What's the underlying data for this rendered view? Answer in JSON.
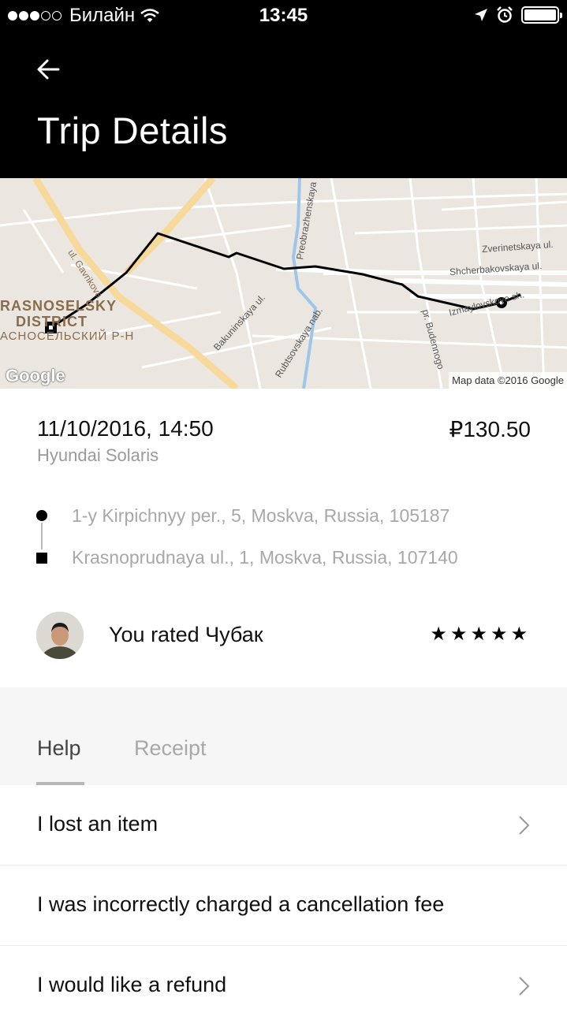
{
  "status_bar": {
    "carrier": "Билайн",
    "time": "13:45"
  },
  "header": {
    "title": "Trip Details"
  },
  "map": {
    "street_labels": {
      "gavrikova": "ul. Gavrikova",
      "preobrazhenskaya": "Preobrazhenskaya",
      "zverinetskaya": "Zverinetskaya ul.",
      "shcherbakovskaya": "Shcherbakovskaya ul.",
      "izmaylovskoye": "Izmaylovskoye sh.",
      "budennogo": "pr. Budennogo",
      "bakuninskaya": "Bakuninskaya ul.",
      "rubtsovskaya": "Rubtsovskaya nab."
    },
    "district_line1": "RASNOSELSKY",
    "district_line2": "DISTRICT",
    "district_ru": "АСНОСЕЛЬСКИЙ Р-Н",
    "provider_logo": "Google",
    "attribution": "Map data ©2016 Google"
  },
  "trip": {
    "datetime": "11/10/2016, 14:50",
    "price": "₽130.50",
    "car": "Hyundai Solaris",
    "pickup": "1-y Kirpichnyy per., 5, Moskva, Russia, 105187",
    "dropoff": "Krasnoprudnaya ul., 1, Moskva, Russia, 107140"
  },
  "rating": {
    "text": "You rated Чубак",
    "stars": "★★★★★",
    "star_count": 5
  },
  "tabs": [
    {
      "label": "Help",
      "active": true
    },
    {
      "label": "Receipt",
      "active": false
    }
  ],
  "help_items": [
    {
      "label": "I lost an item",
      "chevron": true
    },
    {
      "label": "I was incorrectly charged a cancellation fee",
      "chevron": false
    },
    {
      "label": "I would like a refund",
      "chevron": true
    }
  ]
}
